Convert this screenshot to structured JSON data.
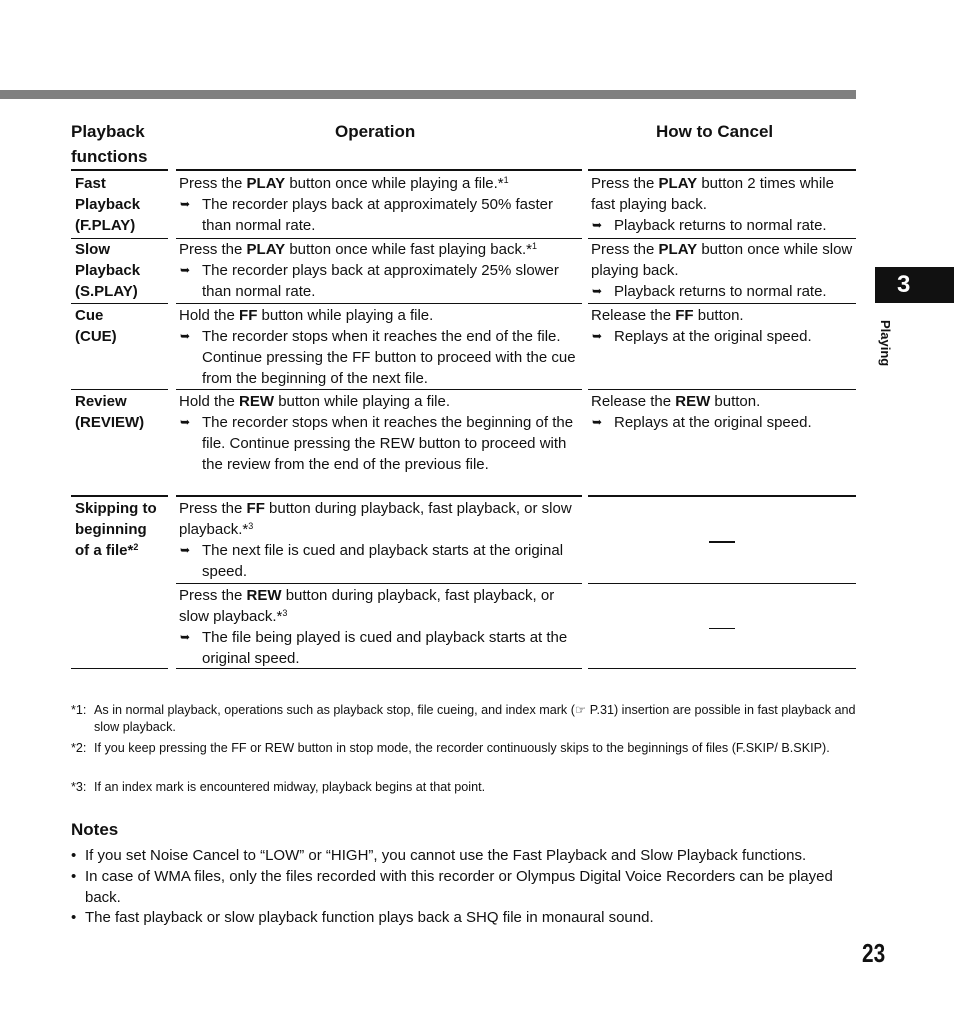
{
  "headers": {
    "functions": [
      "Playback",
      "functions"
    ],
    "operation": "Operation",
    "cancel": "How to Cancel"
  },
  "rows": [
    {
      "func": [
        "Fast",
        "Playback",
        "(F.PLAY)"
      ],
      "op_pre": "Press the ",
      "op_bold": "PLAY",
      "op_post": " button once while playing a file.*",
      "op_sup": "1",
      "op_result": "The recorder plays back at approximately 50% faster than normal rate.",
      "cancel_pre": "Press the ",
      "cancel_bold": "PLAY",
      "cancel_post": " button 2 times while fast playing back.",
      "cancel_result": "Playback returns to normal rate."
    },
    {
      "func": [
        "Slow",
        "Playback",
        "(S.PLAY)"
      ],
      "op_pre": "Press the ",
      "op_bold": "PLAY",
      "op_post": " button once while fast playing back.*",
      "op_sup": "1",
      "op_result": "The recorder plays back at approximately 25% slower than normal rate.",
      "cancel_pre": "Press the ",
      "cancel_bold": "PLAY",
      "cancel_post": " button once while slow playing back.",
      "cancel_result": "Playback returns to normal rate."
    },
    {
      "func": [
        "Cue",
        "(CUE)"
      ],
      "op_pre": "Hold the ",
      "op_bold": "FF",
      "op_post": " button while playing a file.",
      "op_sup": "",
      "op_result": "The recorder stops when it reaches the end of the file. Continue pressing the FF button to proceed with the cue from the beginning of the next file.",
      "cancel_pre": "Release the ",
      "cancel_bold": "FF",
      "cancel_post": " button.",
      "cancel_result": "Replays at the original speed."
    },
    {
      "func": [
        "Review",
        "(REVIEW)"
      ],
      "op_pre": "Hold the ",
      "op_bold": "REW",
      "op_post": " button while playing a file.",
      "op_sup": "",
      "op_result": "The recorder stops when it reaches the beginning of the file. Continue pressing the REW button to proceed with the review from the end of the previous file.",
      "cancel_pre": "Release the ",
      "cancel_bold": "REW",
      "cancel_post": " button.",
      "cancel_result": "Replays at the original speed."
    },
    {
      "func": [
        "Skipping to",
        "beginning",
        "of a file*"
      ],
      "func_sup": "2",
      "op_pre": "Press the ",
      "op_bold": "FF",
      "op_post": " button during playback, fast playback, or slow playback.*",
      "op_sup": "3",
      "op_result": "The next file is cued and playback starts at the original speed.",
      "cancel": "—"
    },
    {
      "op_pre": "Press the ",
      "op_bold": "REW",
      "op_post": " button during playback, fast playback, or slow playback.*",
      "op_sup": "3",
      "op_result": "The file being played is cued and playback starts at the original speed.",
      "cancel": "—"
    }
  ],
  "footnotes": [
    {
      "mark": "*1:",
      "text": "As in normal playback, operations such as playback stop, file cueing, and index mark (☞ P.31) insertion are possible in fast playback and slow playback."
    },
    {
      "mark": "*2:",
      "text": "If you keep pressing the FF or REW button in stop mode, the recorder continuously skips to the beginnings of files (F.SKIP/ B.SKIP)."
    },
    {
      "mark": "*3:",
      "text": "If an index mark is encountered midway, playback begins at that point."
    }
  ],
  "notes": {
    "title": "Notes",
    "items": [
      "If you set Noise Cancel to “LOW” or “HIGH”, you cannot use the Fast Playback and Slow Playback functions.",
      "In case of WMA files, only the files recorded with this recorder or Olympus Digital Voice Recorders can be played back.",
      "The fast playback or slow playback function plays back a SHQ file in monaural sound."
    ]
  },
  "chapter_tab": {
    "number": "3",
    "label": "Playing"
  },
  "page_number": "23",
  "icons": {
    "arrow": "➥",
    "bullet": "•"
  }
}
